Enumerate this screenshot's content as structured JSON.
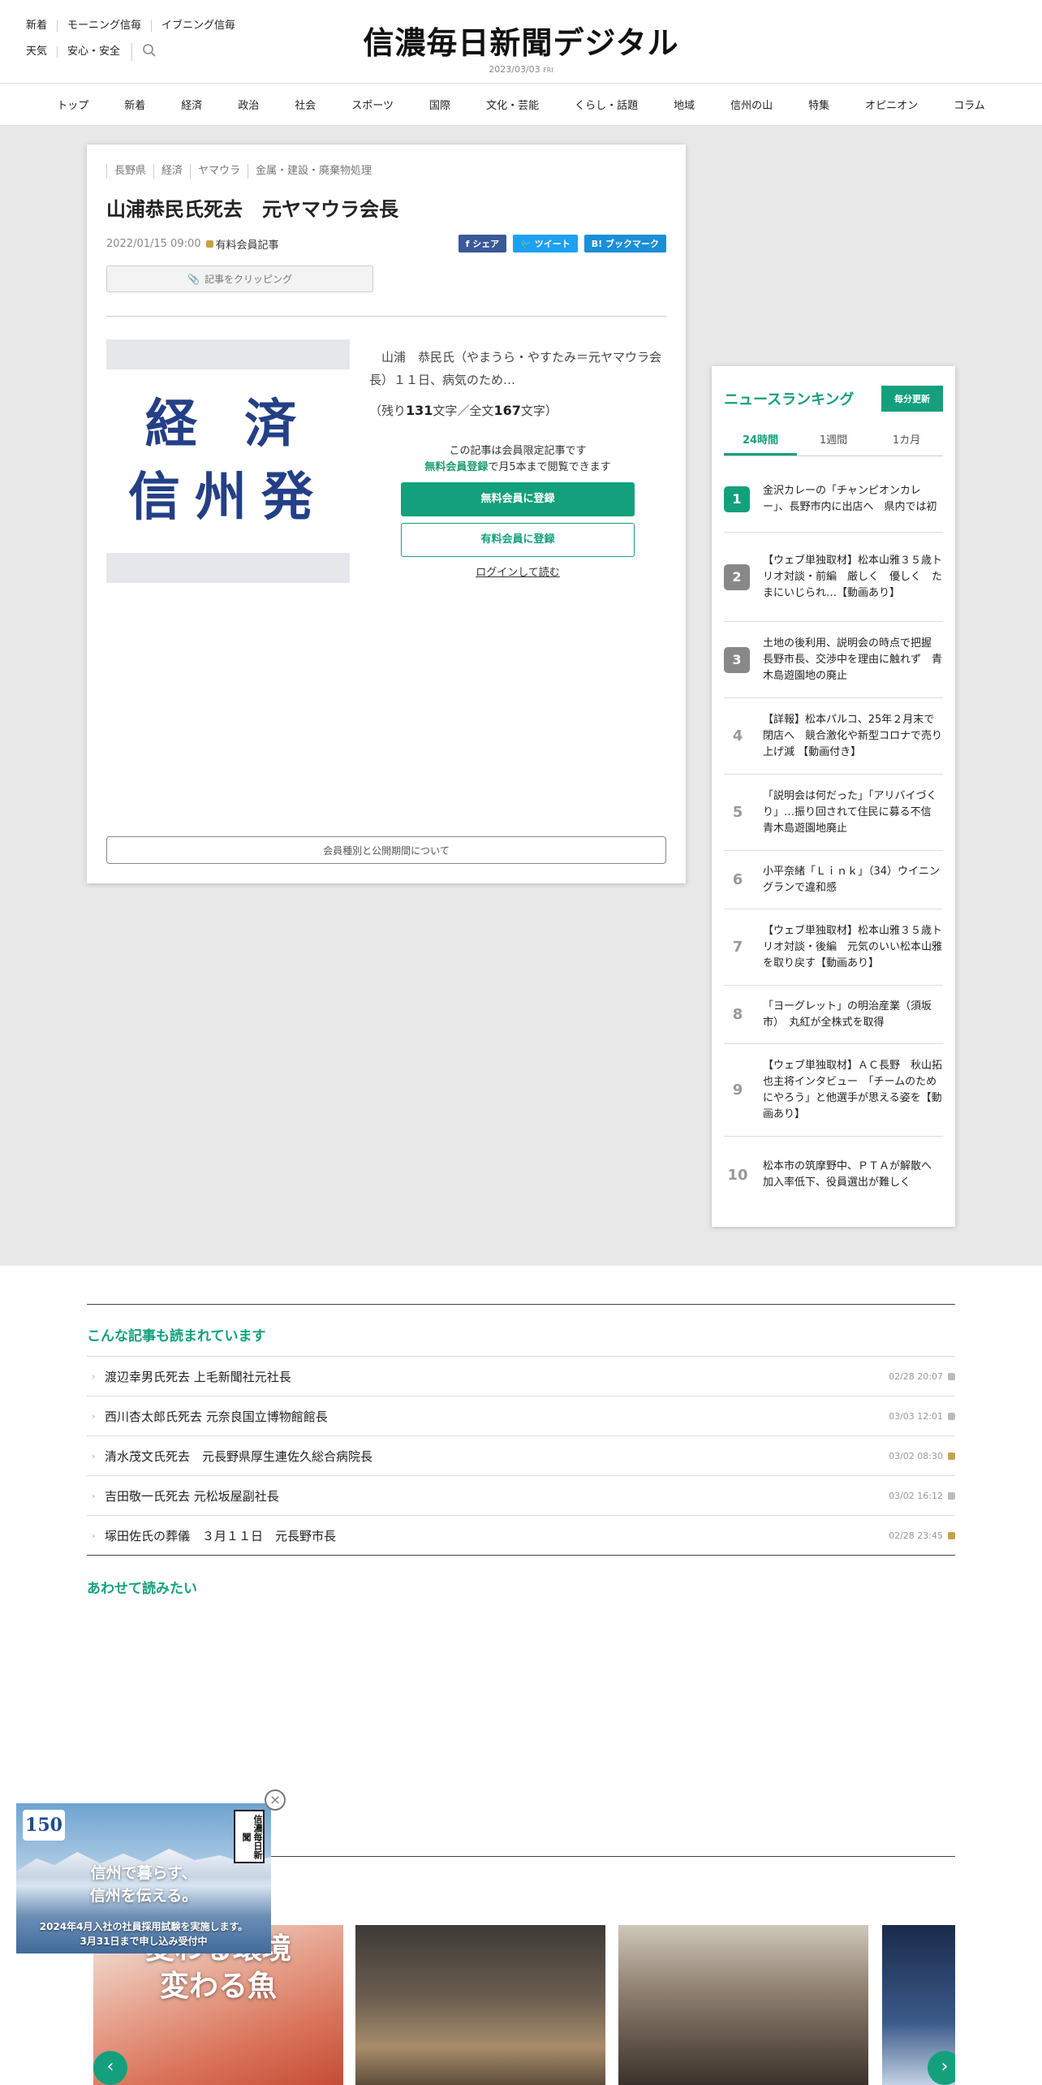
{
  "header": {
    "links_row1": [
      "新着",
      "モーニング信毎",
      "イブニング信毎"
    ],
    "links_row2": [
      "天気",
      "安心・安全"
    ],
    "logo": "信濃毎日新聞デジタル",
    "date": "2023/03/03",
    "weekday": "FRI"
  },
  "nav": [
    "トップ",
    "新着",
    "経済",
    "政治",
    "社会",
    "スポーツ",
    "国際",
    "文化・芸能",
    "くらし・話題",
    "地域",
    "信州の山",
    "特集",
    "オピニオン",
    "コラム"
  ],
  "article": {
    "tags": [
      "長野県",
      "経済",
      "ヤマウラ",
      "金属・建設・廃棄物処理"
    ],
    "title": "山浦恭民氏死去　元ヤマウラ会長",
    "date": "2022/01/15 09:00",
    "member_label": "有料会員記事",
    "share": {
      "facebook": "f シェア",
      "twitter": "ツイート",
      "bookmark": "B! ブックマーク"
    },
    "clip_label": "記事をクリッピング",
    "thumb_line1": "経 済",
    "thumb_line2": "信州発",
    "lead": "山浦　恭民氏（やまうら・やすたみ＝元ヤマウラ会長）１１日、病気のため…",
    "remain_pre": "（残り",
    "remain_count": "131",
    "remain_mid": "文字／全文",
    "total_count": "167",
    "remain_post": "文字）",
    "limited_line1": "この記事は会員限定記事です",
    "limited_free_link": "無料会員登録",
    "limited_line2_rest": "で月5本まで閲覧できます",
    "btn_free": "無料会員に登録",
    "btn_paid": "有料会員に登録",
    "login": "ログインして読む",
    "member_info": "会員種別と公開期間について"
  },
  "ranking": {
    "title": "ニュースランキング",
    "update": "毎分更新",
    "tabs": [
      "24時間",
      "1週間",
      "1カ月"
    ],
    "active_tab": "24時間",
    "items": [
      {
        "rank": "1",
        "text": "金沢カレーの「チャンピオンカレー」、長野市内に出店へ　県内では初"
      },
      {
        "rank": "2",
        "text": "【ウェブ単独取材】松本山雅３５歳トリオ対談・前編　厳しく　優しく　たまにいじられ…【動画あり】"
      },
      {
        "rank": "3",
        "text": "土地の後利用、説明会の時点で把握　長野市長、交渉中を理由に触れず　青木島遊園地の廃止"
      },
      {
        "rank": "4",
        "text": "【詳報】松本パルコ、25年２月末で閉店へ　競合激化や新型コロナで売り上げ減 【動画付き】"
      },
      {
        "rank": "5",
        "text": "「説明会は何だった」「アリバイづくり」…振り回されて住民に募る不信　青木島遊園地廃止"
      },
      {
        "rank": "6",
        "text": "小平奈緒「Ｌｉｎｋ」（34）ウイニングランで違和感"
      },
      {
        "rank": "7",
        "text": "【ウェブ単独取材】松本山雅３５歳トリオ対談・後編　元気のいい松本山雅を取り戻す【動画あり】"
      },
      {
        "rank": "8",
        "text": "「ヨーグレット」の明治産業（須坂市）　丸紅が全株式を取得"
      },
      {
        "rank": "9",
        "text": "【ウェブ単独取材】ＡＣ長野　秋山拓也主将インタビュー　「チームのためにやろう」と他選手が思える姿を【動画あり】"
      },
      {
        "rank": "10",
        "text": "松本市の筑摩野中、ＰＴＡが解散へ　加入率低下、役員選出が難しく"
      }
    ]
  },
  "related": {
    "title": "こんな記事も読まれています",
    "items": [
      {
        "text": "渡辺幸男氏死去 上毛新聞社元社長",
        "time": "02/28 20:07",
        "lock": "grey"
      },
      {
        "text": "西川杏太郎氏死去 元奈良国立博物館館長",
        "time": "03/03 12:01",
        "lock": "grey"
      },
      {
        "text": "清水茂文氏死去　元長野県厚生連佐久総合病院長",
        "time": "03/02 08:30",
        "lock": "gold"
      },
      {
        "text": "吉田敬一氏死去 元松坂屋副社長",
        "time": "03/02 16:12",
        "lock": "grey"
      },
      {
        "text": "塚田佐氏の葬儀　３月１１日　元長野市長",
        "time": "02/28 23:45",
        "lock": "gold"
      }
    ]
  },
  "recommend": {
    "title": "あわせて読みたい"
  },
  "carousel": {
    "slide1_caption_line1": "変わる環境",
    "slide1_caption_line2": "変わる魚"
  },
  "ad": {
    "badge": "150",
    "seal": "信濃毎日新聞",
    "copy_line1": "信州で暮らす、",
    "copy_line2": "信州を伝える。",
    "foot_line1": "2024年4月入社の社員採用試験を実施します。",
    "foot_line2": "3月31日まで申し込み受付中"
  }
}
